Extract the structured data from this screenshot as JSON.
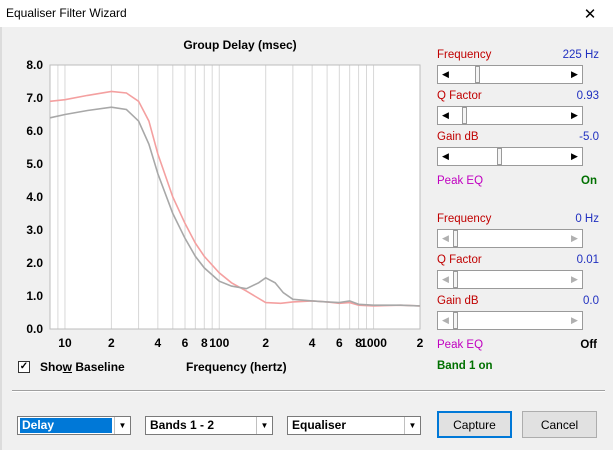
{
  "window": {
    "title": "Equaliser Filter Wizard",
    "close_symbol": "✕"
  },
  "chart_data": {
    "type": "line",
    "title": "Group Delay (msec)",
    "xlabel": "Frequency (hertz)",
    "ylabel": "",
    "x_scale": "log",
    "xlim": [
      8,
      2000
    ],
    "ylim": [
      0,
      8
    ],
    "yticks": [
      "8.0",
      "7.0",
      "6.0",
      "5.0",
      "4.0",
      "3.0",
      "2.0",
      "1.0",
      "0.0"
    ],
    "xticks": [
      {
        "value": 10,
        "label": "10"
      },
      {
        "value": 20,
        "label": "2"
      },
      {
        "value": 40,
        "label": "4"
      },
      {
        "value": 60,
        "label": "6"
      },
      {
        "value": 80,
        "label": "8"
      },
      {
        "value": 100,
        "label": "100"
      },
      {
        "value": 200,
        "label": "2"
      },
      {
        "value": 400,
        "label": "4"
      },
      {
        "value": 600,
        "label": "6"
      },
      {
        "value": 800,
        "label": "8"
      },
      {
        "value": 1000,
        "label": "1000"
      },
      {
        "value": 2000,
        "label": "2"
      }
    ],
    "grid": true,
    "series": [
      {
        "color": "#f4a0a0",
        "x": [
          8,
          10,
          14,
          20,
          25,
          30,
          35,
          40,
          50,
          60,
          70,
          80,
          100,
          120,
          150,
          200,
          250,
          300,
          400,
          500,
          600,
          700,
          800,
          1000,
          1500,
          2000
        ],
        "y": [
          6.9,
          6.95,
          7.08,
          7.2,
          7.15,
          6.9,
          6.3,
          5.3,
          4.0,
          3.2,
          2.6,
          2.2,
          1.7,
          1.4,
          1.15,
          0.8,
          0.78,
          0.82,
          0.85,
          0.82,
          0.78,
          0.8,
          0.72,
          0.7,
          0.72,
          0.7
        ]
      },
      {
        "color": "#a8a8a8",
        "x": [
          8,
          10,
          14,
          20,
          25,
          30,
          35,
          40,
          50,
          60,
          70,
          80,
          100,
          120,
          150,
          180,
          200,
          230,
          260,
          300,
          400,
          500,
          600,
          700,
          800,
          1000,
          1500,
          2000
        ],
        "y": [
          6.4,
          6.5,
          6.62,
          6.72,
          6.65,
          6.3,
          5.6,
          4.7,
          3.5,
          2.75,
          2.2,
          1.85,
          1.45,
          1.3,
          1.22,
          1.4,
          1.55,
          1.4,
          1.1,
          0.9,
          0.85,
          0.82,
          0.8,
          0.85,
          0.75,
          0.72,
          0.72,
          0.7
        ]
      }
    ]
  },
  "band1": {
    "frequency_label": "Frequency",
    "frequency_value": "225 Hz",
    "frequency_pos": 0.2,
    "q_label": "Q Factor",
    "q_value": "0.93",
    "q_pos": 0.08,
    "gain_label": "Gain  dB",
    "gain_value": "-5.0",
    "gain_pos": 0.4,
    "type_label": "Peak EQ",
    "state": "On"
  },
  "band2": {
    "frequency_label": "Frequency",
    "frequency_value": "0 Hz",
    "q_label": "Q Factor",
    "q_value": "0.01",
    "gain_label": "Gain  dB",
    "gain_value": "0.0",
    "type_label": "Peak EQ",
    "state": "Off"
  },
  "band_status": "Band 1 on",
  "show_baseline": {
    "pre": "Sho",
    "underline": "w",
    "post": " Baseline",
    "checked_symbol": "✓"
  },
  "controls": {
    "view_select": "Delay",
    "bands_select": "Bands 1 - 2",
    "mode_select": "Equaliser",
    "capture_label": "Capture",
    "cancel_label": "Cancel",
    "dropdown_symbol": "▼",
    "arrow_left": "◀",
    "arrow_right": "▶"
  }
}
